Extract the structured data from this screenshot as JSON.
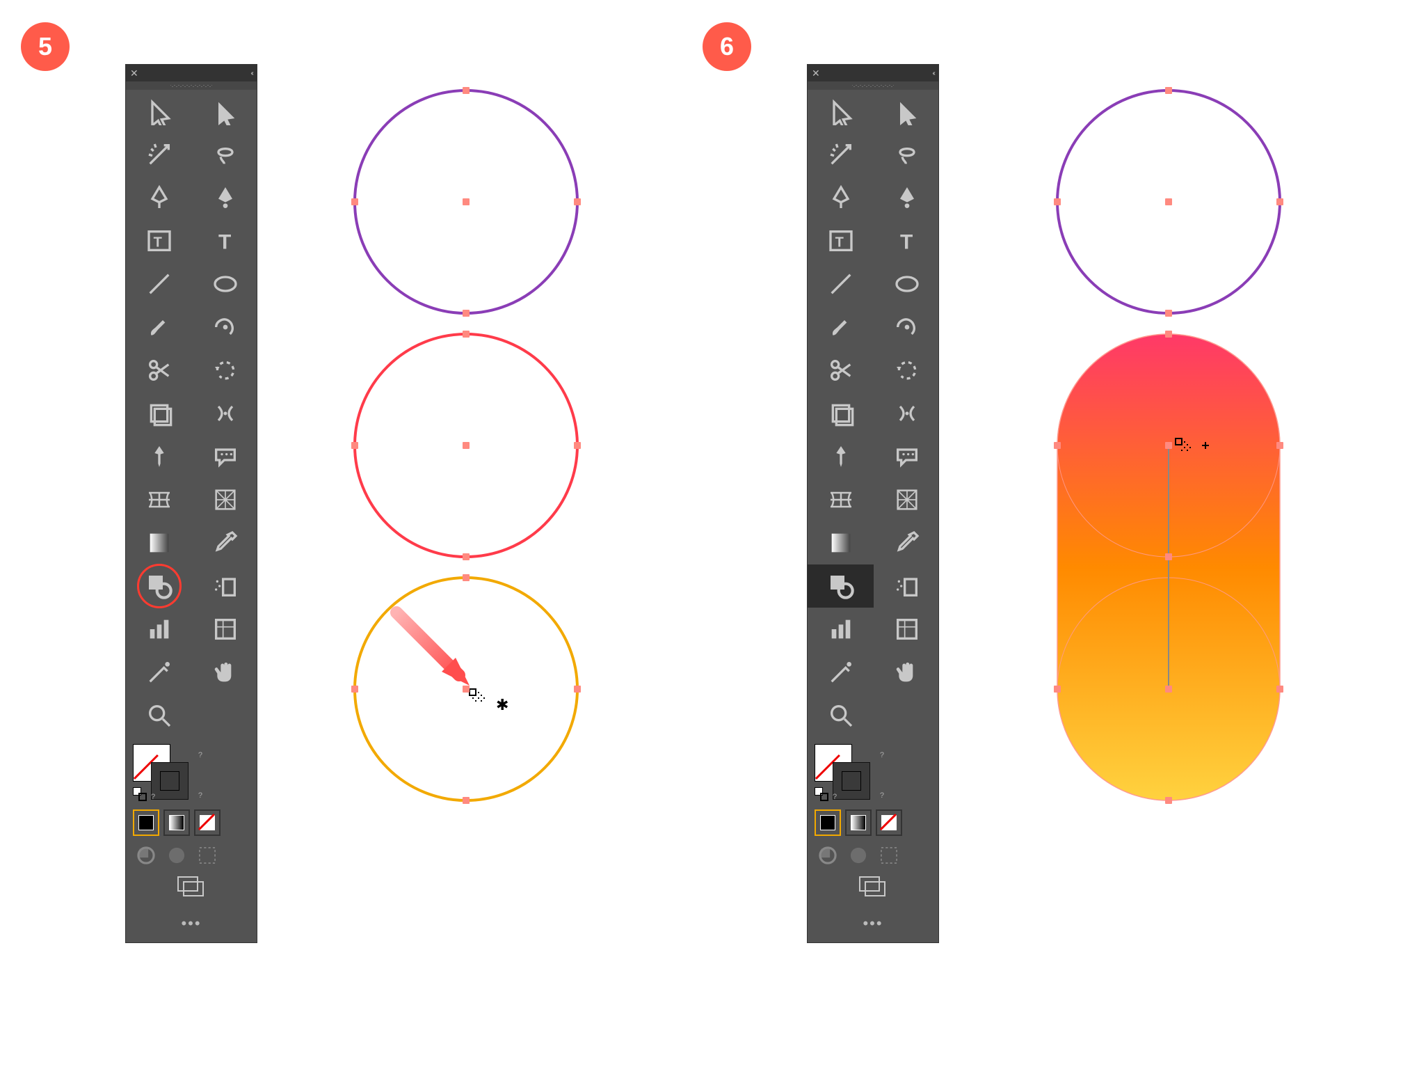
{
  "steps": [
    {
      "badge": "5",
      "shape_builder_highlighted": true
    },
    {
      "badge": "6",
      "shape_builder_highlighted": false
    }
  ],
  "panel": {
    "close_glyph": "✕",
    "collapse_glyph": "‹‹",
    "more_glyph": "•••",
    "fill_q": "?",
    "stroke_q": "?",
    "tiny_q": "?"
  },
  "tools": [
    "selection",
    "direct-selection",
    "magic-wand",
    "lasso",
    "pen",
    "curvature",
    "touch-type",
    "type",
    "line",
    "ellipse",
    "brush",
    "eraser",
    "scissors",
    "rotate",
    "free-transform",
    "width",
    "pin",
    "speech",
    "mesh-row",
    "mesh",
    "gradient",
    "eyedropper",
    "shape-builder",
    "symbol-spray",
    "column",
    "slice",
    "knife",
    "hand",
    "zoom",
    "blank"
  ],
  "colors": {
    "circle_purple": "#8a3db6",
    "circle_red": "#ff3b4a",
    "circle_orange": "#f2a900",
    "handle": "#ff9a8f",
    "grad_top": "#ff3968",
    "grad_mid": "#ff8a00",
    "grad_bot": "#ffd23f"
  }
}
